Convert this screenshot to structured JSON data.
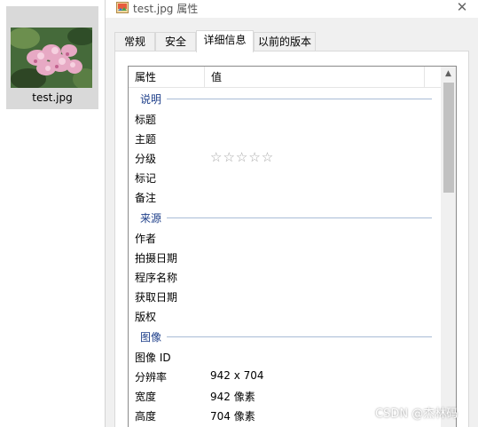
{
  "file": {
    "name": "test.jpg"
  },
  "dialog": {
    "title": "test.jpg 属性",
    "close_glyph": "✕",
    "tabs": [
      {
        "label": "常规"
      },
      {
        "label": "安全"
      },
      {
        "label": "详细信息"
      },
      {
        "label": "以前的版本"
      }
    ],
    "active_tab": "详细信息"
  },
  "details": {
    "header": {
      "property": "属性",
      "value": "值"
    },
    "groups": [
      {
        "name": "说明",
        "rows": [
          {
            "key": "标题",
            "value": ""
          },
          {
            "key": "主题",
            "value": ""
          },
          {
            "key": "分级",
            "value": "",
            "rating": "0 of 5"
          },
          {
            "key": "标记",
            "value": ""
          },
          {
            "key": "备注",
            "value": ""
          }
        ]
      },
      {
        "name": "来源",
        "rows": [
          {
            "key": "作者",
            "value": ""
          },
          {
            "key": "拍摄日期",
            "value": ""
          },
          {
            "key": "程序名称",
            "value": ""
          },
          {
            "key": "获取日期",
            "value": ""
          },
          {
            "key": "版权",
            "value": ""
          }
        ]
      },
      {
        "name": "图像",
        "rows": [
          {
            "key": "图像 ID",
            "value": ""
          },
          {
            "key": "分辨率",
            "value": "942 x 704"
          },
          {
            "key": "宽度",
            "value": "942 像素"
          },
          {
            "key": "高度",
            "value": "704 像素"
          }
        ]
      }
    ],
    "rating_stars": "☆☆☆☆☆"
  },
  "scrollbar": {
    "up_glyph": "▲"
  },
  "watermark": "CSDN @杰林码",
  "colors": {
    "group_header": "#1e3f8a",
    "group_line": "#a9bcd6",
    "tile_bg": "#d9d9d9",
    "dialog_bg": "#f0f0f0"
  },
  "icons": {
    "title": "image-file-icon",
    "close": "close-icon",
    "scroll_up": "chevron-up-icon"
  }
}
